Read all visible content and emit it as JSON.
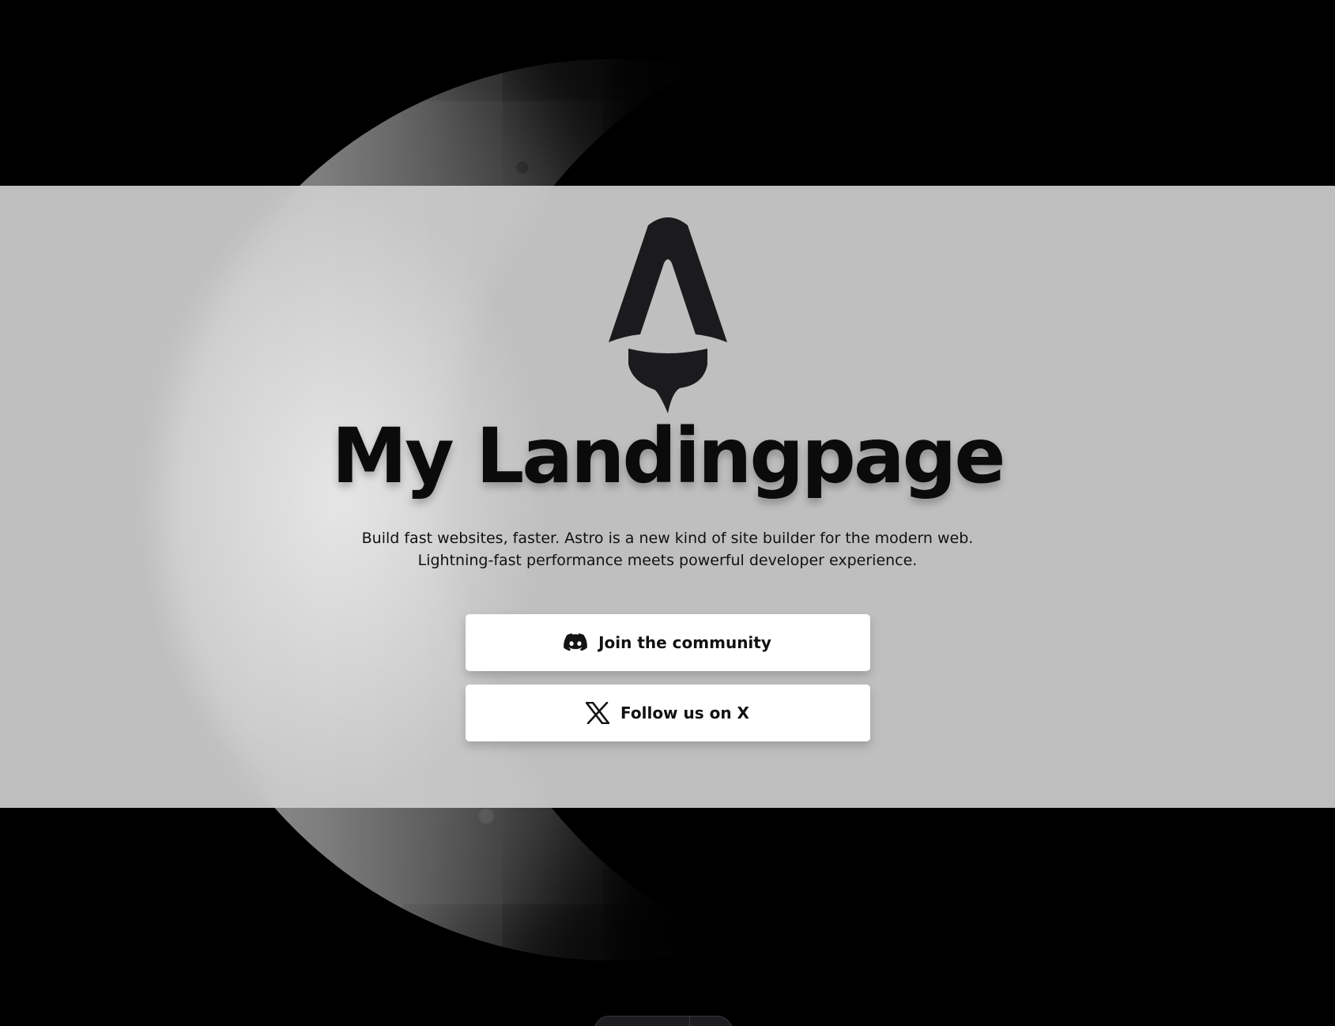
{
  "hero": {
    "title": "My Landingpage",
    "subtitle_line1": "Build fast websites, faster. Astro is a new kind of site builder for the modern web.",
    "subtitle_line2": "Lightning-fast performance meets powerful developer experience."
  },
  "buttons": [
    {
      "label": "Join the community",
      "icon": "discord-icon"
    },
    {
      "label": "Follow us on X",
      "icon": "x-logo-icon"
    }
  ],
  "colors": {
    "background": "#000000",
    "band": "#cdcdcd",
    "button_bg": "#ffffff",
    "text": "#0b0b0b"
  }
}
